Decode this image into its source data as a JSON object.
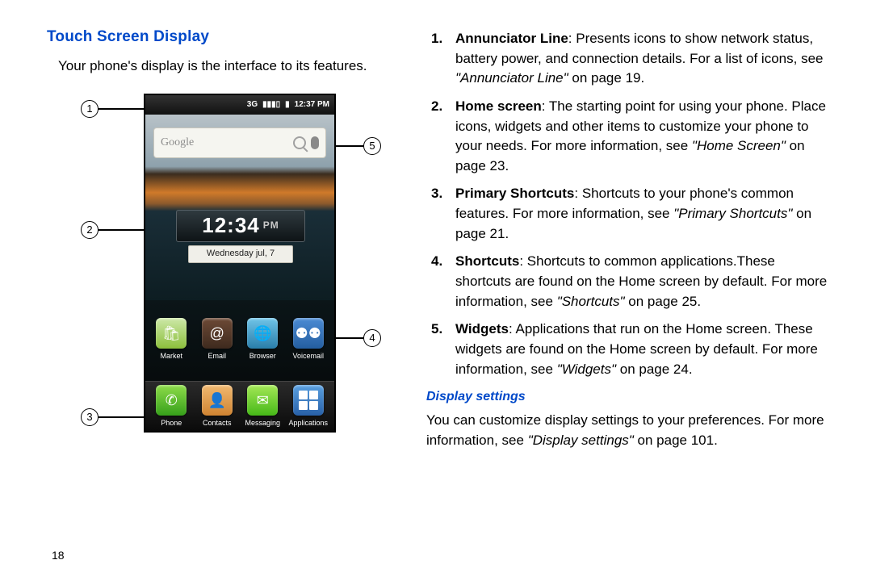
{
  "left": {
    "heading": "Touch Screen Display",
    "intro": "Your phone's display is the interface to its features.",
    "callouts": {
      "c1": "1",
      "c2": "2",
      "c3": "3",
      "c4": "4",
      "c5": "5"
    },
    "statusbar": {
      "net": "3G",
      "time": "12:37 PM"
    },
    "search": {
      "placeholder": "Google"
    },
    "clock": {
      "time": "12:34",
      "ampm": "PM",
      "date": "Wednesday   jul,  7"
    },
    "shortcuts": [
      {
        "label": "Market"
      },
      {
        "label": "Email"
      },
      {
        "label": "Browser"
      },
      {
        "label": "Voicemail"
      }
    ],
    "dock": [
      {
        "label": "Phone"
      },
      {
        "label": "Contacts"
      },
      {
        "label": "Messaging"
      },
      {
        "label": "Applications"
      }
    ]
  },
  "right": {
    "items": [
      {
        "term": "Annunciator Line",
        "body": ": Presents icons to show network status, battery power, and connection details. For a list of icons, see ",
        "ref": "\"Annunciator Line\"",
        "tail": " on page 19."
      },
      {
        "term": "Home screen",
        "body": ": The starting point for using your phone. Place icons, widgets and other items to customize your phone to your needs. For more information, see ",
        "ref": "\"Home Screen\"",
        "tail": " on page 23."
      },
      {
        "term": "Primary Shortcuts",
        "body": ": Shortcuts to your phone's common features. For more information, see ",
        "ref": "\"Primary Shortcuts\"",
        "tail": " on page 21."
      },
      {
        "term": "Shortcuts",
        "body": ": Shortcuts to common applications.These shortcuts are found on the Home screen by default. For more information, see ",
        "ref": "\"Shortcuts\"",
        "tail": " on page 25."
      },
      {
        "term": "Widgets",
        "body": ": Applications that run on the Home screen. These widgets are found on the Home screen by default. For more information, see ",
        "ref": "\"Widgets\"",
        "tail": " on page 24."
      }
    ],
    "sub": {
      "heading": "Display settings",
      "body1": "You can customize display settings to your preferences. For more information, see ",
      "ref": "\"Display settings\"",
      "tail": " on page 101."
    }
  },
  "pagenum": "18"
}
